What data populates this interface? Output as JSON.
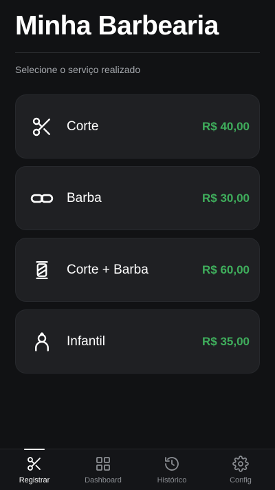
{
  "header": {
    "title": "Minha Barbearia",
    "subtitle": "Selecione o serviço realizado"
  },
  "services": [
    {
      "icon": "scissors-icon",
      "name": "Corte",
      "price": "R$ 40,00"
    },
    {
      "icon": "link-icon",
      "name": "Barba",
      "price": "R$ 30,00"
    },
    {
      "icon": "barber-pole-icon",
      "name": "Corte + Barba",
      "price": "R$ 60,00"
    },
    {
      "icon": "child-icon",
      "name": "Infantil",
      "price": "R$ 35,00"
    }
  ],
  "nav": {
    "items": [
      {
        "icon": "scissors-icon",
        "label": "Registrar",
        "active": true
      },
      {
        "icon": "grid-icon",
        "label": "Dashboard",
        "active": false
      },
      {
        "icon": "history-icon",
        "label": "Histórico",
        "active": false
      },
      {
        "icon": "gear-icon",
        "label": "Config",
        "active": false
      }
    ]
  },
  "colors": {
    "background": "#111214",
    "card": "#1f2023",
    "price": "#3fae5c",
    "muted": "#8c8f94"
  }
}
